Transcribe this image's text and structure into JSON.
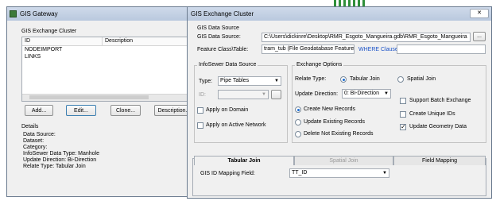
{
  "gateway": {
    "title": "GIS Gateway",
    "cluster_group": "GIS Exchange Cluster",
    "columns": [
      "ID",
      "Description"
    ],
    "rows": [
      "NODEIMPORT",
      "LINKS"
    ],
    "buttons": [
      "Add...",
      "Edit...",
      "Clone...",
      "Description..."
    ],
    "details_label": "Details",
    "details": [
      "Data Source:",
      "Dataset:",
      "Category:",
      "InfoSewer Data Type: Manhole",
      "Update Direction: Bi-Direction",
      "Relate Type: Tabular Join"
    ]
  },
  "cluster": {
    "title": "GIS Exchange Cluster",
    "close_glyph": "✕",
    "gis_data_source_group": "GIS Data Source",
    "gis_data_source_label": "GIS Data Source:",
    "gis_data_source_value": "C:\\Users\\dickinre\\Desktop\\RMR_Esgoto_Mangueira.gdb\\RMR_Esgoto_Mangueira",
    "browse_label": "...",
    "feature_class_label": "Feature Class\\Table:",
    "feature_class_value": "tram_tub (File Geodatabase Feature",
    "where_label": "WHERE Clause:",
    "infosewer_group": "InfoSewer Data Source",
    "type_label": "Type:",
    "type_value": "Pipe Tables",
    "id_label": "ID:",
    "apply_domain": "Apply on Domain",
    "apply_network": "Apply on Active Network",
    "exchange_group": "Exchange Options",
    "relate_type_label": "Relate Type:",
    "tabular_join": "Tabular Join",
    "spatial_join": "Spatial Join",
    "update_direction_label": "Update Direction:",
    "update_direction_value": "0: Bi-Direction",
    "create_new": "Create New Records",
    "update_existing": "Update Existing Records",
    "delete_not_existing": "Delete Not Existing Records",
    "support_batch": "Support Batch Exchange",
    "create_unique_ids": "Create Unique IDs",
    "update_geometry": "Update Geometry Data",
    "tabs": [
      "Tabular Join",
      "Spatial Join",
      "Field Mapping"
    ],
    "gis_id_mapping_label": "GIS ID Mapping Field:",
    "gis_id_mapping_value": "TT_ID"
  },
  "colors": {
    "accent_blue": "#1a52c8",
    "titlebar": "#c4d3e6",
    "panel": "#f0f0f0"
  },
  "icons": {
    "window": "gateway-icon",
    "dropdown": "chevron-down-icon",
    "close": "close-icon",
    "check": "checkmark-icon"
  }
}
